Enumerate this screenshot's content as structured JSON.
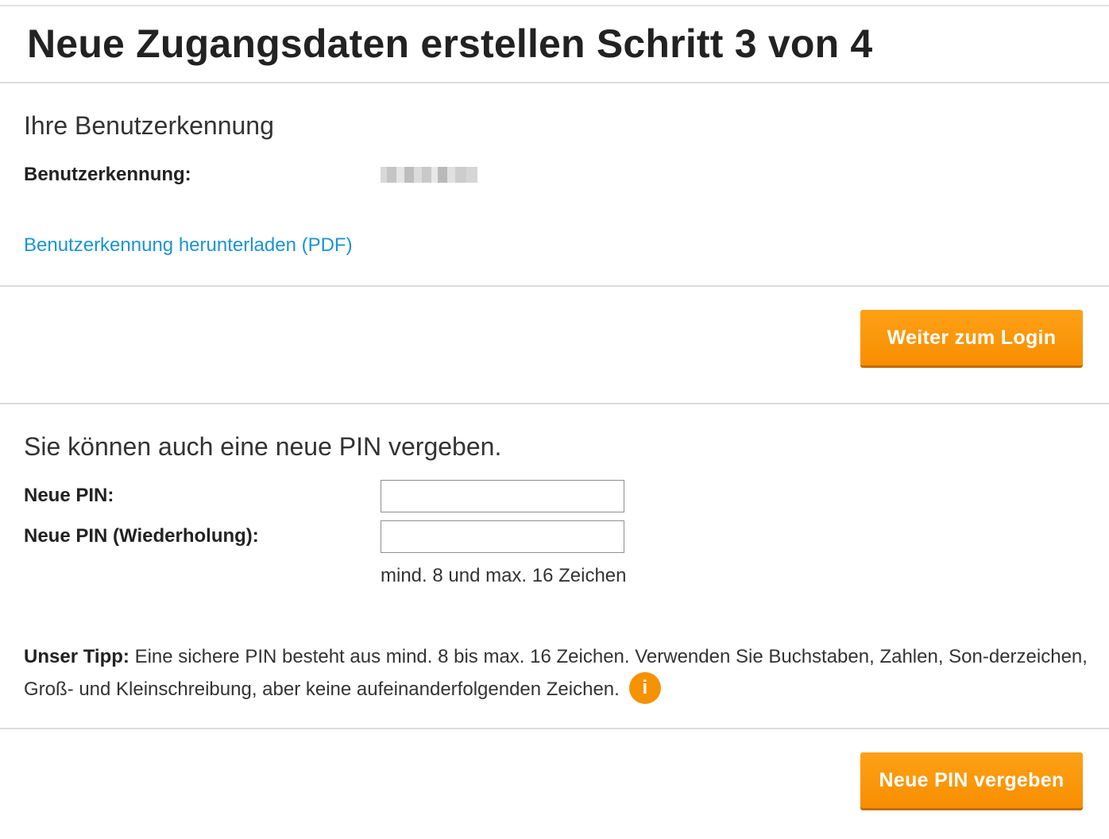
{
  "page": {
    "title": "Neue Zugangsdaten erstellen Schritt 3 von 4"
  },
  "user_section": {
    "heading": "Ihre Benutzerkennung",
    "user_id_label": "Benutzerkennung:",
    "download_link": "Benutzerkennung herunterladen (PDF)"
  },
  "login": {
    "button_label": "Weiter zum Login"
  },
  "pin_section": {
    "heading": "Sie können auch eine neue PIN vergeben.",
    "new_pin_label": "Neue PIN:",
    "new_pin_value": "",
    "repeat_pin_label": "Neue PIN (Wiederholung):",
    "repeat_pin_value": "",
    "length_hint": "mind. 8 und max. 16 Zeichen",
    "tip_label": "Unser Tipp:",
    "tip_text": " Eine sichere PIN besteht aus mind. 8 bis max. 16 Zeichen. Verwenden Sie Buchstaben, Zahlen, Son-derzeichen, Groß- und Kleinschreibung, aber keine aufeinanderfolgenden Zeichen.",
    "info_icon_glyph": "i",
    "submit_label": "Neue PIN vergeben"
  },
  "colors": {
    "accent_orange": "#f88e00",
    "link_blue": "#1a94d1",
    "divider": "#dcdcdc"
  }
}
